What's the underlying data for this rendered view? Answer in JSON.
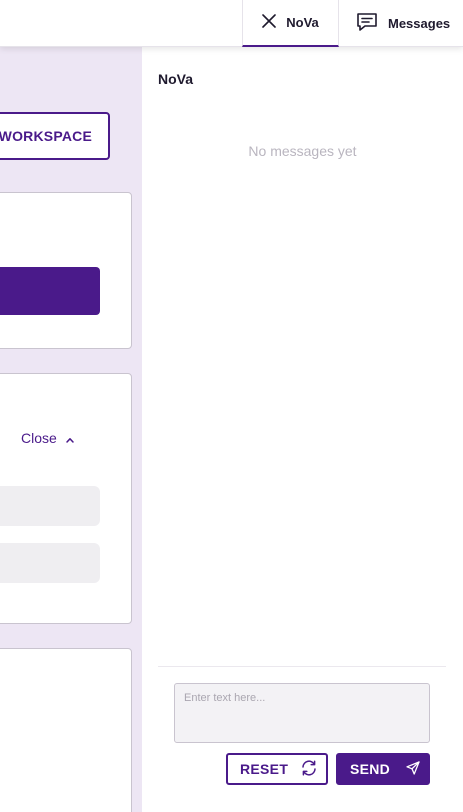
{
  "colors": {
    "accent": "#4a1a8a",
    "workspace_bg": "#ede6f4"
  },
  "header": {
    "tabs": [
      {
        "label": "NoVa",
        "icon": "close-icon",
        "active": true
      },
      {
        "label": "Messages",
        "icon": "chat-icon",
        "active": false
      }
    ]
  },
  "workspace": {
    "workspace_button_label": "WORKSPACE",
    "close_label": "Close",
    "close_icon": "chevron-up-icon"
  },
  "chat": {
    "title": "NoVa",
    "empty_text": "No messages yet",
    "input_placeholder": "Enter text here...",
    "reset_label": "RESET",
    "reset_icon": "refresh-icon",
    "send_label": "SEND",
    "send_icon": "send-icon"
  }
}
